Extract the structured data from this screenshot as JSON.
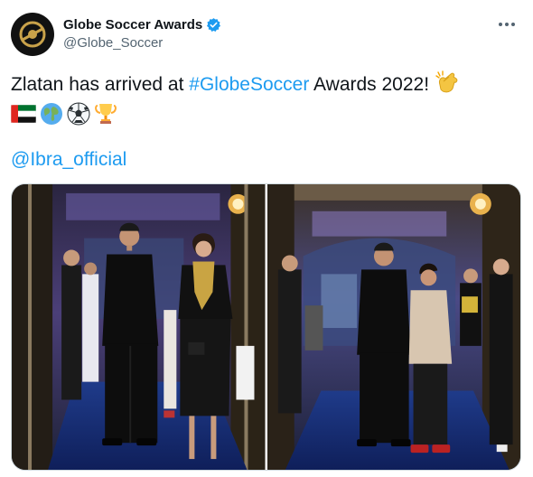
{
  "account": {
    "display_name": "Globe Soccer Awards",
    "handle": "@Globe_Soccer"
  },
  "tweet": {
    "text_prefix": "Zlatan has arrived at ",
    "hashtag": "#GlobeSoccer",
    "text_suffix": " Awards 2022! ",
    "emojis": [
      "uae-flag-icon",
      "globe-icon",
      "soccer-ball-icon",
      "trophy-icon"
    ],
    "mention": "@Ibra_official"
  },
  "colors": {
    "link": "#1d9bf0",
    "verified": "#1d9bf0",
    "text": "#0f1419",
    "secondary": "#536471"
  }
}
